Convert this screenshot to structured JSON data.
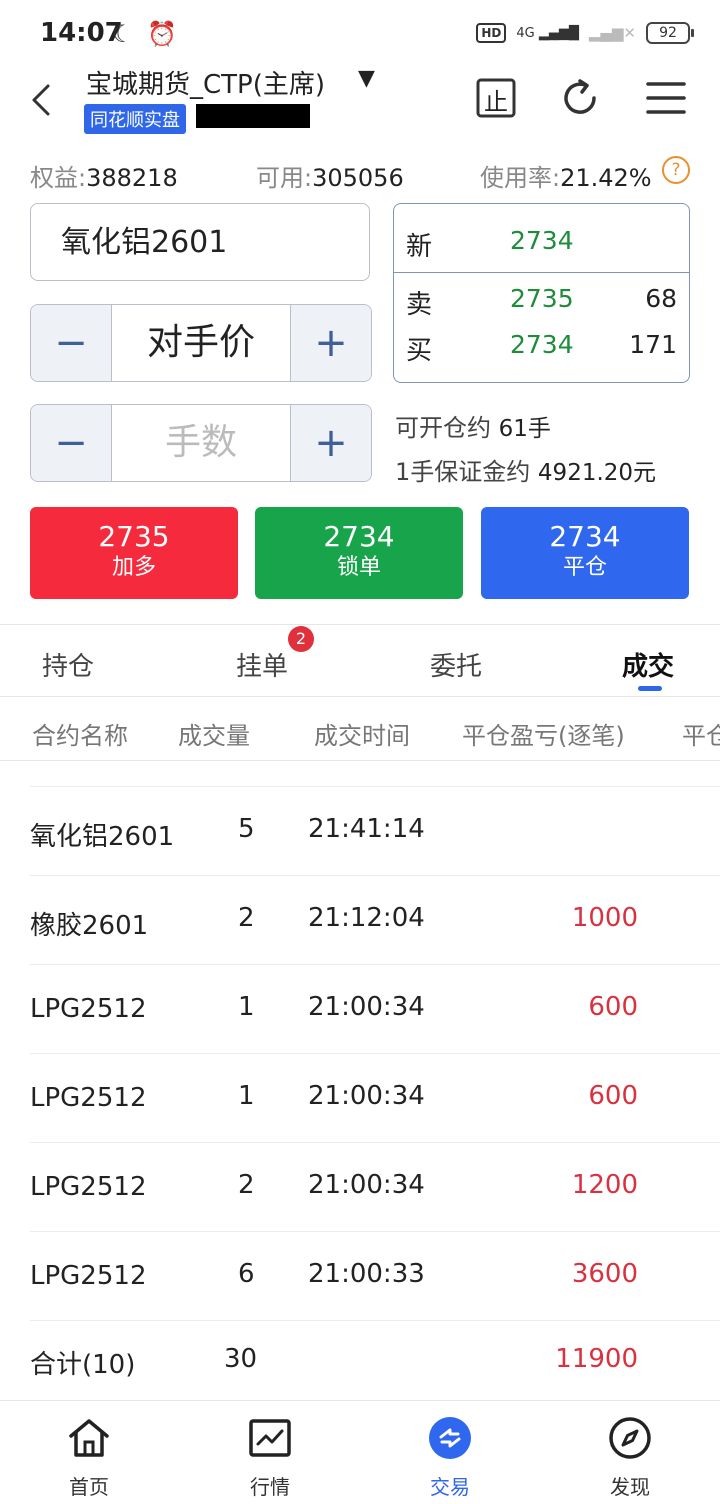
{
  "status_bar": {
    "time": "14:07",
    "signal_label": "4G",
    "battery": "92"
  },
  "header": {
    "title": "宝城期货_CTP(主席)",
    "dropdown_icon": "caret-down-icon",
    "tag": "同花顺实盘",
    "stop_label": "止"
  },
  "account": {
    "equity_label": "权益:",
    "equity_value": "388218",
    "available_label": "可用:",
    "available_value": "305056",
    "usage_label": "使用率:",
    "usage_value": "21.42%",
    "help_label": "?"
  },
  "order": {
    "contract": "氧化铝2601",
    "price_mode": "对手价",
    "quantity_placeholder": "手数",
    "minus_label": "−",
    "plus_label": "+"
  },
  "quote": {
    "last_label": "新",
    "last_price": "2734",
    "ask_label": "卖",
    "ask_price": "2735",
    "ask_volume": "68",
    "bid_label": "买",
    "bid_price": "2734",
    "bid_volume": "171"
  },
  "info": {
    "open_label": "可开仓约",
    "open_value": "61手",
    "margin_label": "1手保证金约",
    "margin_value": "4921.20元"
  },
  "actions": [
    {
      "price": "2735",
      "label": "加多",
      "color": "#f52a3c"
    },
    {
      "price": "2734",
      "label": "锁单",
      "color": "#18a44b"
    },
    {
      "price": "2734",
      "label": "平仓",
      "color": "#2f67ee"
    }
  ],
  "tabs": {
    "holdings": "持仓",
    "pending": "挂单",
    "pending_badge": "2",
    "orders": "委托",
    "trades": "成交"
  },
  "table": {
    "headers": [
      "合约名称",
      "成交量",
      "成交时间",
      "平仓盈亏(逐笔)",
      "平仓"
    ],
    "rows": [
      {
        "name": "氧化铝2601",
        "volume": "5",
        "time": "21:41:14",
        "pnl": ""
      },
      {
        "name": "橡胶2601",
        "volume": "2",
        "time": "21:12:04",
        "pnl": "1000"
      },
      {
        "name": "LPG2512",
        "volume": "1",
        "time": "21:00:34",
        "pnl": "600"
      },
      {
        "name": "LPG2512",
        "volume": "1",
        "time": "21:00:34",
        "pnl": "600"
      },
      {
        "name": "LPG2512",
        "volume": "2",
        "time": "21:00:34",
        "pnl": "1200"
      },
      {
        "name": "LPG2512",
        "volume": "6",
        "time": "21:00:33",
        "pnl": "3600"
      }
    ],
    "total": {
      "label": "合计(10)",
      "volume": "30",
      "pnl": "11900"
    }
  },
  "bottom_nav": [
    {
      "label": "首页",
      "icon": "home-icon"
    },
    {
      "label": "行情",
      "icon": "chart-icon"
    },
    {
      "label": "交易",
      "icon": "trade-icon"
    },
    {
      "label": "发现",
      "icon": "compass-icon"
    }
  ]
}
